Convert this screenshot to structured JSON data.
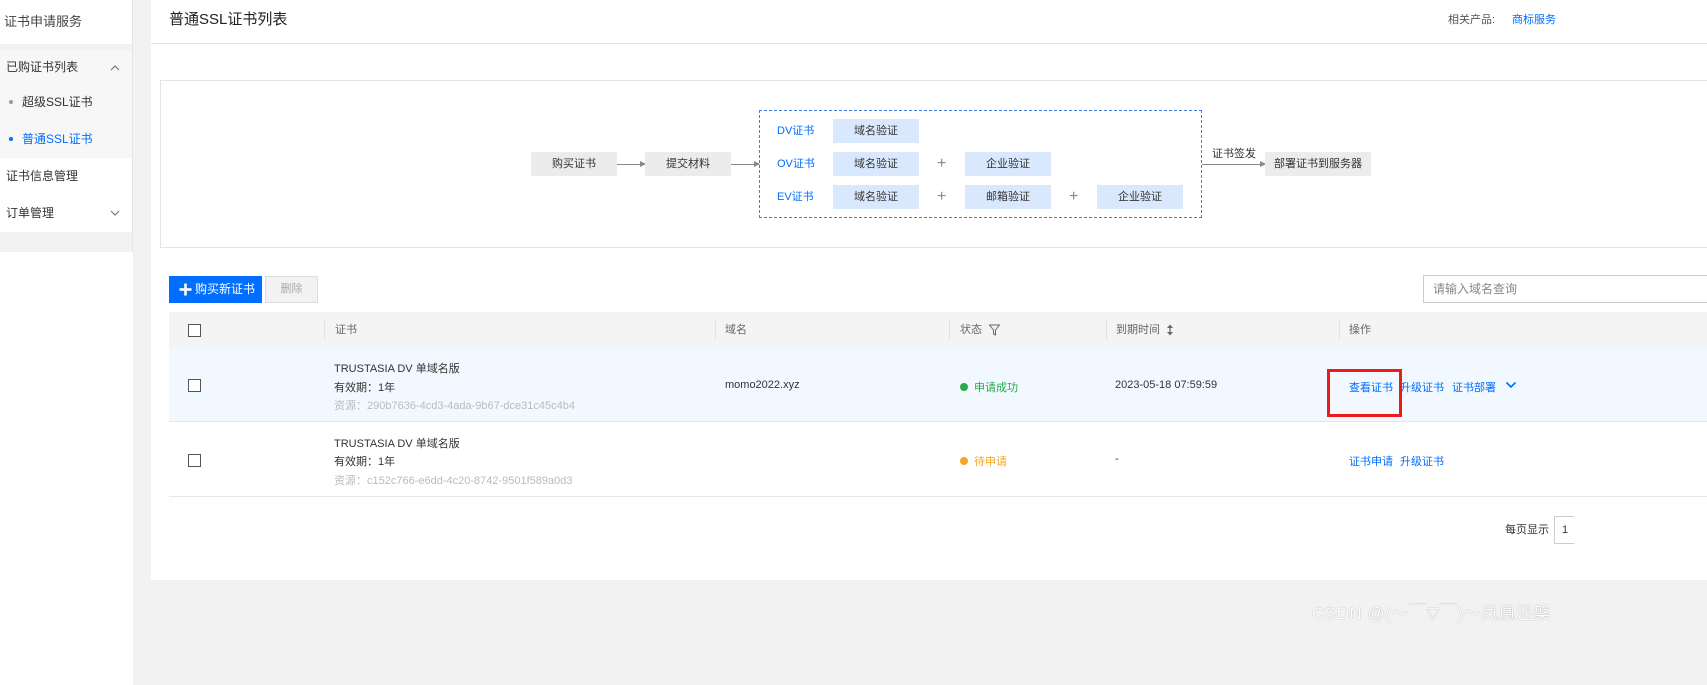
{
  "sidebar": {
    "title": "证书申请服务",
    "group_purchased": "已购证书列表",
    "sub_items": [
      "超级SSL证书",
      "普通SSL证书"
    ],
    "cert_info": "证书信息管理",
    "orders": "订单管理"
  },
  "header": {
    "title": "普通SSL证书列表",
    "related_label": "相关产品:",
    "related_link": "商标服务"
  },
  "flow": {
    "buy": "购买证书",
    "submit": "提交材料",
    "dv": "DV证书",
    "ov": "OV证书",
    "ev": "EV证书",
    "domain_verify": "域名验证",
    "company_verify": "企业验证",
    "email_verify": "邮箱验证",
    "plus": "+",
    "issue": "证书签发",
    "deploy": "部署证书到服务器"
  },
  "toolbar": {
    "buy_new": "购买新证书",
    "delete": "删除",
    "search_placeholder": "请输入域名查询"
  },
  "table": {
    "headers": [
      "证书",
      "域名",
      "状态",
      "到期时间",
      "操作"
    ],
    "rows": [
      {
        "name": "TRUSTASIA DV 单域名版",
        "validity": "有效期：1年",
        "resource": "资源：290b7636-4cd3-4ada-9b67-dce31c45c4b4",
        "domain": "momo2022.xyz",
        "status": "申请成功",
        "expiry": "2023-05-18 07:59:59",
        "actions": [
          "查看证书",
          "升级证书",
          "证书部署"
        ]
      },
      {
        "name": "TRUSTASIA DV 单域名版",
        "validity": "有效期：1年",
        "resource": "资源：c152c766-e6dd-4c20-8742-9501f589a0d3",
        "domain": "",
        "status": "待申请",
        "expiry": "-",
        "actions": [
          "证书申请",
          "升级证书"
        ]
      }
    ]
  },
  "pagination": {
    "per_page_label": "每页显示",
    "per_page_value": "1"
  },
  "watermark": "CSDN @(～￣▽￣)～凤凰涅槃",
  "colors": {
    "accent": "#006eff",
    "success": "#2ba84a",
    "pending": "#f5a623",
    "highlight_box": "#f01919"
  }
}
